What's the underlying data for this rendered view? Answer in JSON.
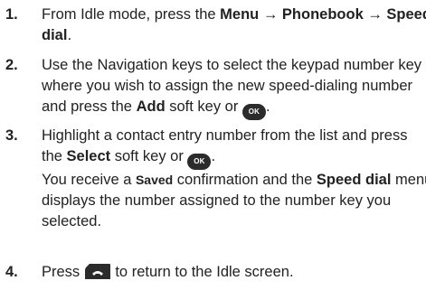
{
  "steps": [
    {
      "number": "1.",
      "lines": [
        {
          "parts": [
            "From Idle mode, press the ",
            "Menu → Phonebook → Speed"
          ]
        },
        {
          "parts": [
            "dial",
            "."
          ]
        }
      ]
    },
    {
      "number": "2.",
      "lines": [
        {
          "parts": [
            "Use the Navigation keys to select the keypad number key"
          ]
        },
        {
          "parts": [
            "where you wish to assign the new speed-dialing number"
          ]
        },
        {
          "parts": [
            "and press the ",
            "Add",
            " soft key or ",
            "."
          ]
        }
      ]
    },
    {
      "number": "3.",
      "lines": [
        {
          "parts": [
            "Highlight a contact entry number from the list and press"
          ]
        },
        {
          "parts": [
            "the ",
            "Select",
            " soft key or ",
            "."
          ]
        },
        {
          "parts": [
            "You receive a ",
            "Saved",
            " confirmation and the ",
            "Speed dial",
            " menu"
          ]
        },
        {
          "parts": [
            "displays the number assigned to the number key you"
          ]
        },
        {
          "parts": [
            "selected."
          ]
        }
      ]
    },
    {
      "number": "4.",
      "lines": [
        {
          "parts": [
            "Press ",
            " to return to the Idle screen."
          ]
        }
      ]
    }
  ],
  "ok_key_label": "OK",
  "end_key_icon": "end-call-key-icon",
  "colors": {
    "text": "#222222",
    "key_background": "#2b2b2b",
    "key_text": "#ffffff"
  }
}
